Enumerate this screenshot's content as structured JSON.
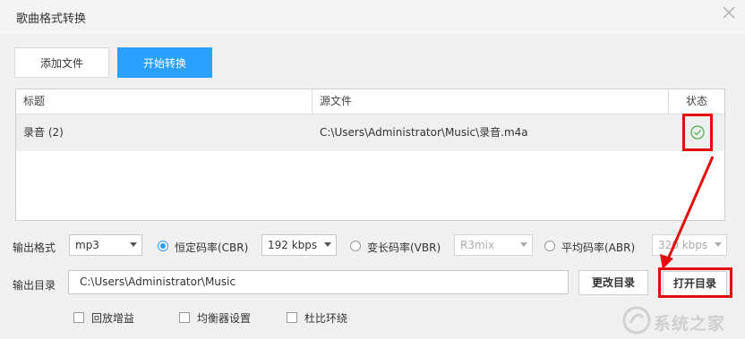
{
  "window": {
    "title": "歌曲格式转换"
  },
  "toolbar": {
    "add_file": "添加文件",
    "start_convert": "开始转换"
  },
  "table": {
    "headers": {
      "title": "标题",
      "source": "源文件",
      "status": "状态"
    },
    "rows": [
      {
        "title": "录音 (2)",
        "source": "C:\\Users\\Administrator\\Music\\录音.m4a",
        "status": "done"
      }
    ]
  },
  "output": {
    "format_label": "输出格式",
    "format_value": "mp3",
    "cbr_label": "恒定码率(CBR)",
    "cbr_value": "192 kbps",
    "vbr_label": "变长码率(VBR)",
    "vbr_value": "R3mix",
    "abr_label": "平均码率(ABR)",
    "abr_value": "320 kbps",
    "selected_mode": "cbr",
    "dir_label": "输出目录",
    "dir_value": "C:\\Users\\Administrator\\Music",
    "change_dir": "更改目录",
    "open_dir": "打开目录"
  },
  "options": {
    "replay_gain": "回放增益",
    "equalizer": "均衡器设置",
    "dolby": "杜比环绕"
  },
  "watermark": {
    "text": "系统之家"
  },
  "colors": {
    "accent": "#2aa0ff",
    "highlight": "#e30b0b",
    "success": "#5cb85c"
  }
}
